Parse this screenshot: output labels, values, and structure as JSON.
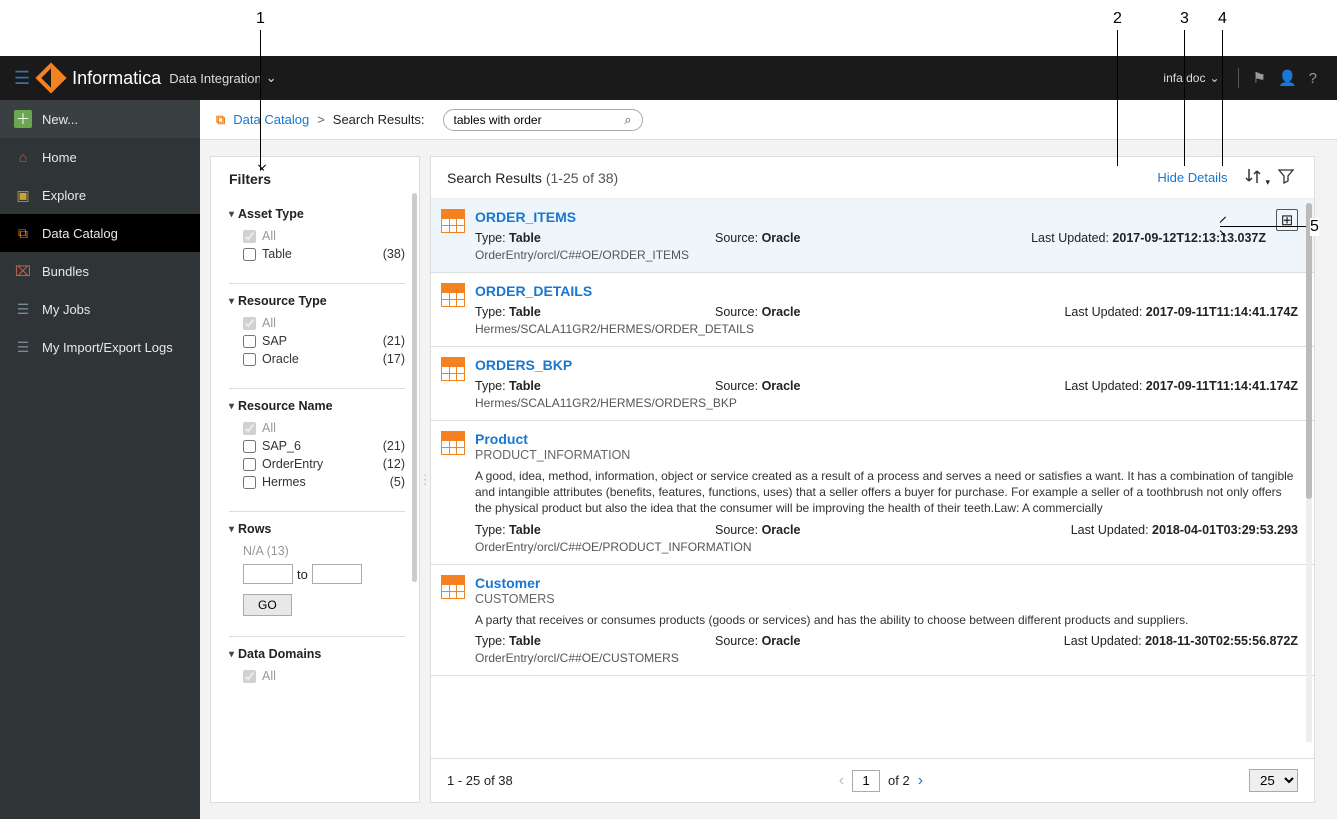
{
  "annotations": {
    "n1": "1",
    "n2": "2",
    "n3": "3",
    "n4": "4",
    "n5": "5"
  },
  "topbar": {
    "brand": "Informatica",
    "product": "Data Integration",
    "user": "infa.doc"
  },
  "sidebar": {
    "new": "New...",
    "items": [
      {
        "label": "Home"
      },
      {
        "label": "Explore"
      },
      {
        "label": "Data Catalog"
      },
      {
        "label": "Bundles"
      },
      {
        "label": "My Jobs"
      },
      {
        "label": "My Import/Export Logs"
      }
    ]
  },
  "breadcrumb": {
    "root": "Data Catalog",
    "sep": ">",
    "current": "Search Results:",
    "search_value": "tables with order"
  },
  "filters": {
    "title": "Filters",
    "assetType": {
      "title": "Asset Type",
      "all": "All",
      "items": [
        {
          "label": "Table",
          "count": "(38)"
        }
      ]
    },
    "resourceType": {
      "title": "Resource Type",
      "all": "All",
      "items": [
        {
          "label": "SAP",
          "count": "(21)"
        },
        {
          "label": "Oracle",
          "count": "(17)"
        }
      ]
    },
    "resourceName": {
      "title": "Resource Name",
      "all": "All",
      "items": [
        {
          "label": "SAP_6",
          "count": "(21)"
        },
        {
          "label": "OrderEntry",
          "count": "(12)"
        },
        {
          "label": "Hermes",
          "count": "(5)"
        }
      ]
    },
    "rows": {
      "title": "Rows",
      "na": "N/A (13)",
      "to": "to",
      "go": "GO"
    },
    "dataDomains": {
      "title": "Data Domains",
      "all": "All"
    }
  },
  "results": {
    "heading": "Search Results",
    "range": "(1-25 of 38)",
    "hideDetails": "Hide Details",
    "typeLabel": "Type:",
    "sourceLabel": "Source:",
    "updatedLabel": "Last Updated:",
    "items": [
      {
        "name": "ORDER_ITEMS",
        "type": "Table",
        "source": "Oracle",
        "updated": "2017-09-12T12:13:13.037Z",
        "path": "OrderEntry/orcl/C##OE/ORDER_ITEMS",
        "expand": true
      },
      {
        "name": "ORDER_DETAILS",
        "type": "Table",
        "source": "Oracle",
        "updated": "2017-09-11T11:14:41.174Z",
        "path": "Hermes/SCALA11GR2/HERMES/ORDER_DETAILS"
      },
      {
        "name": "ORDERS_BKP",
        "type": "Table",
        "source": "Oracle",
        "updated": "2017-09-11T11:14:41.174Z",
        "path": "Hermes/SCALA11GR2/HERMES/ORDERS_BKP"
      },
      {
        "name": "Product",
        "sub": "PRODUCT_INFORMATION",
        "type": "Table",
        "source": "Oracle",
        "updated": "2018-04-01T03:29:53.293",
        "path": "OrderEntry/orcl/C##OE/PRODUCT_INFORMATION",
        "desc": "A good, idea, method, information, object or service created as a result of a process and serves a need or satisfies a want. It has a combination of tangible and intangible attributes (benefits, features, functions, uses) that a seller offers a buyer for purchase. For example a seller of a toothbrush not only offers the physical product but also the idea that the consumer will be improving the health of their teeth.Law: A commercially"
      },
      {
        "name": "Customer",
        "sub": "CUSTOMERS",
        "type": "Table",
        "source": "Oracle",
        "updated": "2018-11-30T02:55:56.872Z",
        "path": "OrderEntry/orcl/C##OE/CUSTOMERS",
        "desc": "A party that receives or consumes products (goods or services) and has the ability to choose between different products and suppliers."
      }
    ],
    "pager": {
      "summary": "1 - 25  of  38",
      "page": "1",
      "of": "of  2",
      "size": "25"
    }
  }
}
